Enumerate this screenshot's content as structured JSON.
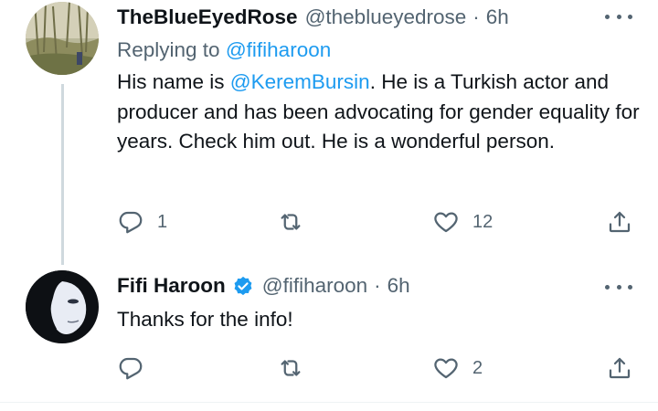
{
  "tweets": [
    {
      "name": "TheBlueEyedRose",
      "handle": "@theblueyedrose",
      "separator": "·",
      "time": "6h",
      "replying_prefix": "Replying to ",
      "replying_handle": "@fifiharoon",
      "text_before": "His name is ",
      "text_mention": "@KeremBursin",
      "text_after": ". He is a Turkish actor and producer and has been advocating for gender equality for years. Check him out. He is a wonderful person.",
      "reply_count": "1",
      "retweet_count": "",
      "like_count": "12",
      "avatar_icon": "forest-photo-avatar"
    },
    {
      "name": "Fifi Haroon",
      "handle": "@fifiharoon",
      "separator": "·",
      "time": "6h",
      "verified": true,
      "text": "Thanks for the info!",
      "reply_count": "",
      "retweet_count": "",
      "like_count": "2",
      "avatar_icon": "portrait-photo-avatar"
    }
  ],
  "colors": {
    "accent": "#1d9bf0",
    "secondary_text": "#536471",
    "primary_text": "#0f1419",
    "thread_line": "#cfd9de"
  },
  "icons": [
    "reply-icon",
    "retweet-icon",
    "like-icon",
    "share-icon",
    "more-icon",
    "verified-badge-icon"
  ]
}
